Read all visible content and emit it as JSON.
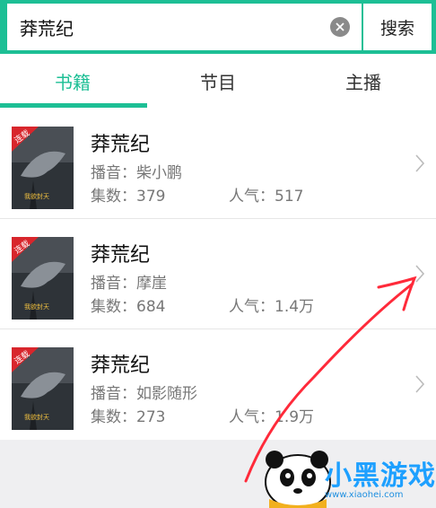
{
  "search": {
    "value": "莽荒纪",
    "button_label": "搜索"
  },
  "tabs": [
    {
      "label": "书籍",
      "active": true
    },
    {
      "label": "节目",
      "active": false
    },
    {
      "label": "主播",
      "active": false
    }
  ],
  "accent_color": "#1dbf95",
  "results": [
    {
      "title": "莽荒纪",
      "host_label": "播音：",
      "host": "柴小鹏",
      "count_label": "集数：",
      "count": "379",
      "pop_label": "人气：",
      "pop": "517",
      "badge": "连载",
      "cover_text": "我欲封天"
    },
    {
      "title": "莽荒纪",
      "host_label": "播音：",
      "host": "摩崖",
      "count_label": "集数：",
      "count": "684",
      "pop_label": "人气：",
      "pop": "1.4万",
      "badge": "连载",
      "cover_text": "我欲封天"
    },
    {
      "title": "莽荒纪",
      "host_label": "播音：",
      "host": "如影随形",
      "count_label": "集数：",
      "count": "273",
      "pop_label": "人气：",
      "pop": "1.9万",
      "badge": "连载",
      "cover_text": "我欲封天"
    }
  ],
  "watermark": {
    "text": "小黑游戏",
    "url": "www.xiaohei.com"
  },
  "icons": {
    "clear": "clear-icon",
    "chevron": "chevron-right-icon",
    "mascot": "panda-icon",
    "annotation": "red-arrow"
  }
}
